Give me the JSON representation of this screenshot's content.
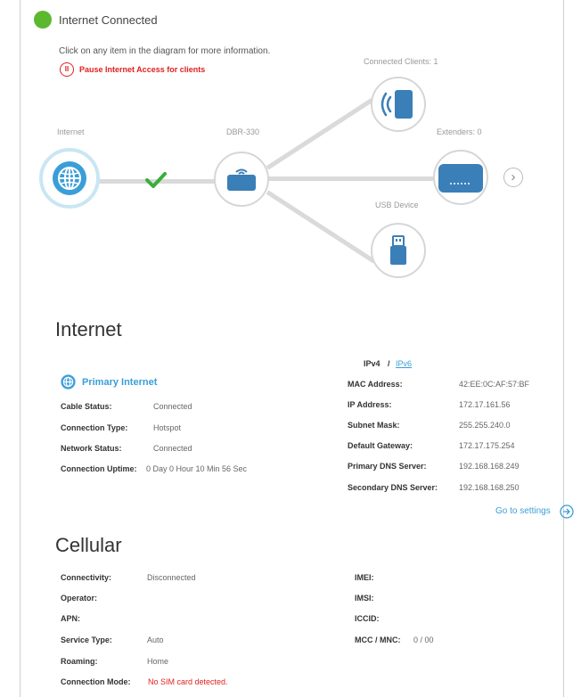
{
  "status": {
    "text": "Internet Connected",
    "hint": "Click on any item in the diagram for more information.",
    "pause_label": "Pause Internet Access for clients",
    "pause_glyph": "II"
  },
  "diagram": {
    "internet_label": "Internet",
    "router_label": "DBR-330",
    "clients_label": "Connected Clients: 1",
    "extenders_label": "Extenders: 0",
    "usb_label": "USB Device",
    "next_glyph": "›"
  },
  "internet": {
    "title": "Internet",
    "primary_label": "Primary Internet",
    "rows": [
      {
        "label": "Cable Status:",
        "value": "Connected"
      },
      {
        "label": "Connection Type:",
        "value": "Hotspot"
      },
      {
        "label": "Network Status:",
        "value": "Connected"
      },
      {
        "label": "Connection Uptime:",
        "value": "0 Day 0 Hour 10 Min 56 Sec"
      }
    ],
    "ipv4_label": "IPv4",
    "ip_sep": "/",
    "ipv6_label": "IPv6",
    "right_rows": [
      {
        "label": "MAC Address:",
        "value": "42:EE:0C:AF:57:BF"
      },
      {
        "label": "IP Address:",
        "value": "172.17.161.56"
      },
      {
        "label": "Subnet Mask:",
        "value": "255.255.240.0"
      },
      {
        "label": "Default Gateway:",
        "value": "172.17.175.254"
      },
      {
        "label": "Primary DNS Server:",
        "value": "192.168.168.249"
      },
      {
        "label": "Secondary DNS Server:",
        "value": "192.168.168.250"
      }
    ],
    "goto_label": "Go to settings"
  },
  "cellular": {
    "title": "Cellular",
    "left_rows": [
      {
        "label": "Connectivity:",
        "value": "Disconnected"
      },
      {
        "label": "Operator:",
        "value": ""
      },
      {
        "label": "APN:",
        "value": ""
      },
      {
        "label": "Service Type:",
        "value": "Auto"
      },
      {
        "label": "Roaming:",
        "value": "Home"
      },
      {
        "label": "Connection Mode:",
        "value": "No SIM card detected."
      }
    ],
    "right_rows": [
      {
        "label": "IMEI:",
        "value": ""
      },
      {
        "label": "IMSI:",
        "value": ""
      },
      {
        "label": "ICCID:",
        "value": ""
      },
      {
        "label": "MCC / MNC:",
        "value": "0 / 00"
      }
    ]
  },
  "colors": {
    "accent": "#3a9ed8",
    "status_green": "#5cb82e",
    "alert_red": "#e02020",
    "node_blue": "#3a7fb8"
  },
  "icons": [
    "status-dot-icon",
    "pause-icon",
    "globe-icon",
    "checkmark-icon",
    "router-icon",
    "phone-wifi-icon",
    "extender-icon",
    "usb-icon",
    "chevron-right-icon",
    "arrow-right-circle-icon"
  ]
}
